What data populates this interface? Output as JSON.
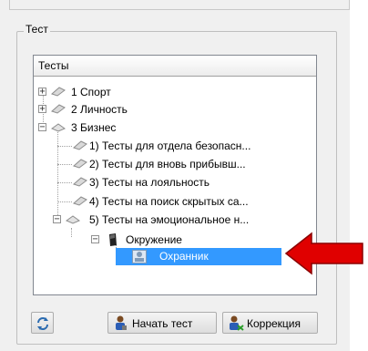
{
  "group": {
    "title": "Тест"
  },
  "tree": {
    "header": "Тесты",
    "nodes": [
      {
        "label": "1 Спорт",
        "expander": "+"
      },
      {
        "label": "2 Личность",
        "expander": "+"
      },
      {
        "label": "3 Бизнес",
        "expander": "−"
      },
      {
        "label": "1) Тесты для отдела безопасн..."
      },
      {
        "label": "2) Тесты для вновь прибывш..."
      },
      {
        "label": "3) Тесты на лояльность"
      },
      {
        "label": "4) Тесты на поиск скрытых са..."
      },
      {
        "label": "5) Тесты на эмоциональное н...",
        "expander": "−"
      },
      {
        "label": "Окружение",
        "expander": "−"
      },
      {
        "label": "Охранник",
        "selected": true
      }
    ]
  },
  "buttons": {
    "refresh": {
      "icon": "refresh-icon"
    },
    "start": {
      "label": "Начать тест",
      "icon": "user-icon"
    },
    "correction": {
      "label": "Коррекция",
      "icon": "user-edit-icon"
    }
  },
  "colors": {
    "selection": "#3399ff",
    "arrow": "#e00000"
  }
}
